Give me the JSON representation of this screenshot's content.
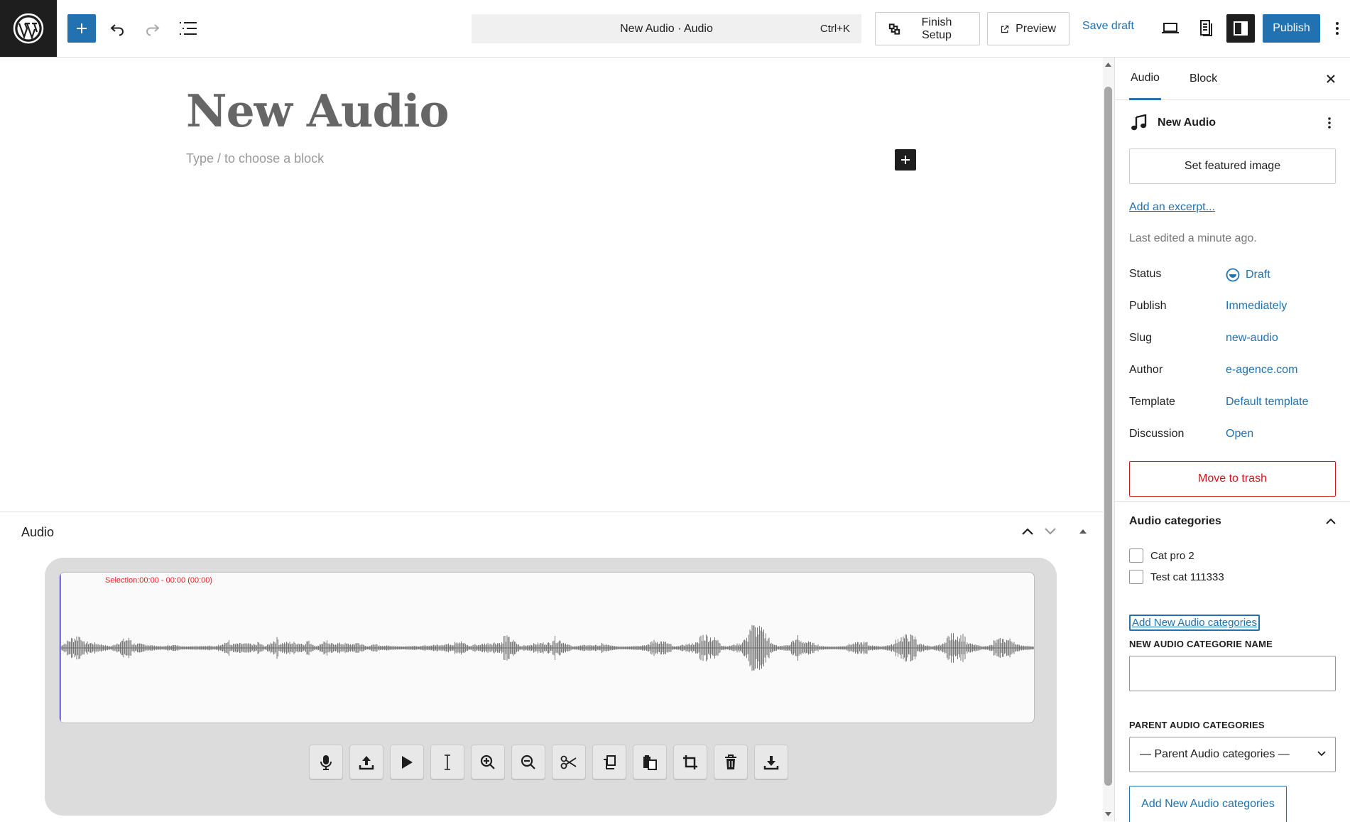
{
  "topbar": {
    "command_title": "New Audio · Audio",
    "command_shortcut": "Ctrl+K",
    "finish_setup": "Finish Setup",
    "preview": "Preview",
    "save_draft": "Save draft",
    "publish": "Publish"
  },
  "editor": {
    "title": "New Audio",
    "block_placeholder": "Type / to choose a block"
  },
  "metabox": {
    "title": "Audio",
    "selection_text": "Selection:00:00 - 00:00 (00:00)",
    "tools": [
      "mic-icon",
      "upload-icon",
      "play-icon",
      "text-cursor-icon",
      "zoom-in-icon",
      "zoom-out-icon",
      "scissors-icon",
      "copy-icon",
      "paste-icon",
      "crop-icon",
      "trash-icon",
      "download-icon"
    ]
  },
  "sidebar": {
    "tabs": [
      "Audio",
      "Block"
    ],
    "doc_title": "New Audio",
    "set_featured_image": "Set featured image",
    "add_excerpt": "Add an excerpt...",
    "last_edited": "Last edited a minute ago.",
    "properties": [
      {
        "key": "Status",
        "value": "Draft"
      },
      {
        "key": "Publish",
        "value": "Immediately"
      },
      {
        "key": "Slug",
        "value": "new-audio"
      },
      {
        "key": "Author",
        "value": "e-agence.com"
      },
      {
        "key": "Template",
        "value": "Default template"
      },
      {
        "key": "Discussion",
        "value": "Open"
      }
    ],
    "move_to_trash": "Move to trash",
    "categories": {
      "heading": "Audio categories",
      "items": [
        "Cat pro 2",
        "Test cat 111333"
      ],
      "add_link": "Add New Audio categories",
      "name_label": "NEW AUDIO CATEGORIE NAME",
      "parent_label": "PARENT AUDIO CATEGORIES",
      "parent_select": "— Parent Audio categories —",
      "add_button": "Add New Audio categories"
    }
  },
  "colors": {
    "accent": "#2271b1",
    "danger": "#cc1818",
    "selection": "#e52020"
  }
}
